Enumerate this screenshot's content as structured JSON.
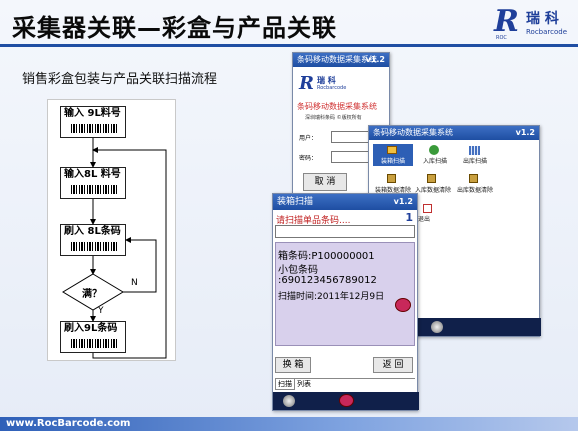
{
  "slide": {
    "title": "采集器关联—彩盒与产品关联",
    "subtitle": "销售彩盒包装与产品关联扫描流程",
    "footer_url": "www.RocBarcode.com"
  },
  "logo": {
    "letter": "R",
    "cn": "瑞 科",
    "en": "Rocbarcode",
    "tag": "ROC"
  },
  "flowchart": {
    "steps": [
      "输入 9L料号",
      "输入8L 料号",
      "刷入 8L条码",
      "满？",
      "刷入9L条码"
    ],
    "labels": {
      "no": "N",
      "yes": "Y"
    }
  },
  "login_window": {
    "title": "条码移动数据采集系统",
    "version": "v1.2",
    "brand": "瑞 科",
    "brand_en": "Rocbarcode",
    "system_name": "条码移动数据采集系统",
    "copyright": "深圳瑞科条码 ©版权所有",
    "user_label": "用户：",
    "password_label": "密码：",
    "cancel_button": "取 消"
  },
  "menu_window": {
    "title": "条码移动数据采集系统",
    "version": "v1.2",
    "items": [
      "装箱扫描",
      "入库扫描",
      "出库扫描",
      "装箱数据清除",
      "入库数据清除",
      "出库数据清除",
      "退出"
    ]
  },
  "scan_window": {
    "title": "装箱扫描",
    "version": "v1.2",
    "prompt": "请扫描单品条码....",
    "count": "1",
    "lines": [
      "箱条码:P100000001",
      "小包条码",
      ":690123456789012",
      "扫描时间:2011年12月9日"
    ],
    "box_button": "换 箱",
    "back_button": "返 回",
    "tabs": [
      "扫描",
      "列表"
    ]
  }
}
